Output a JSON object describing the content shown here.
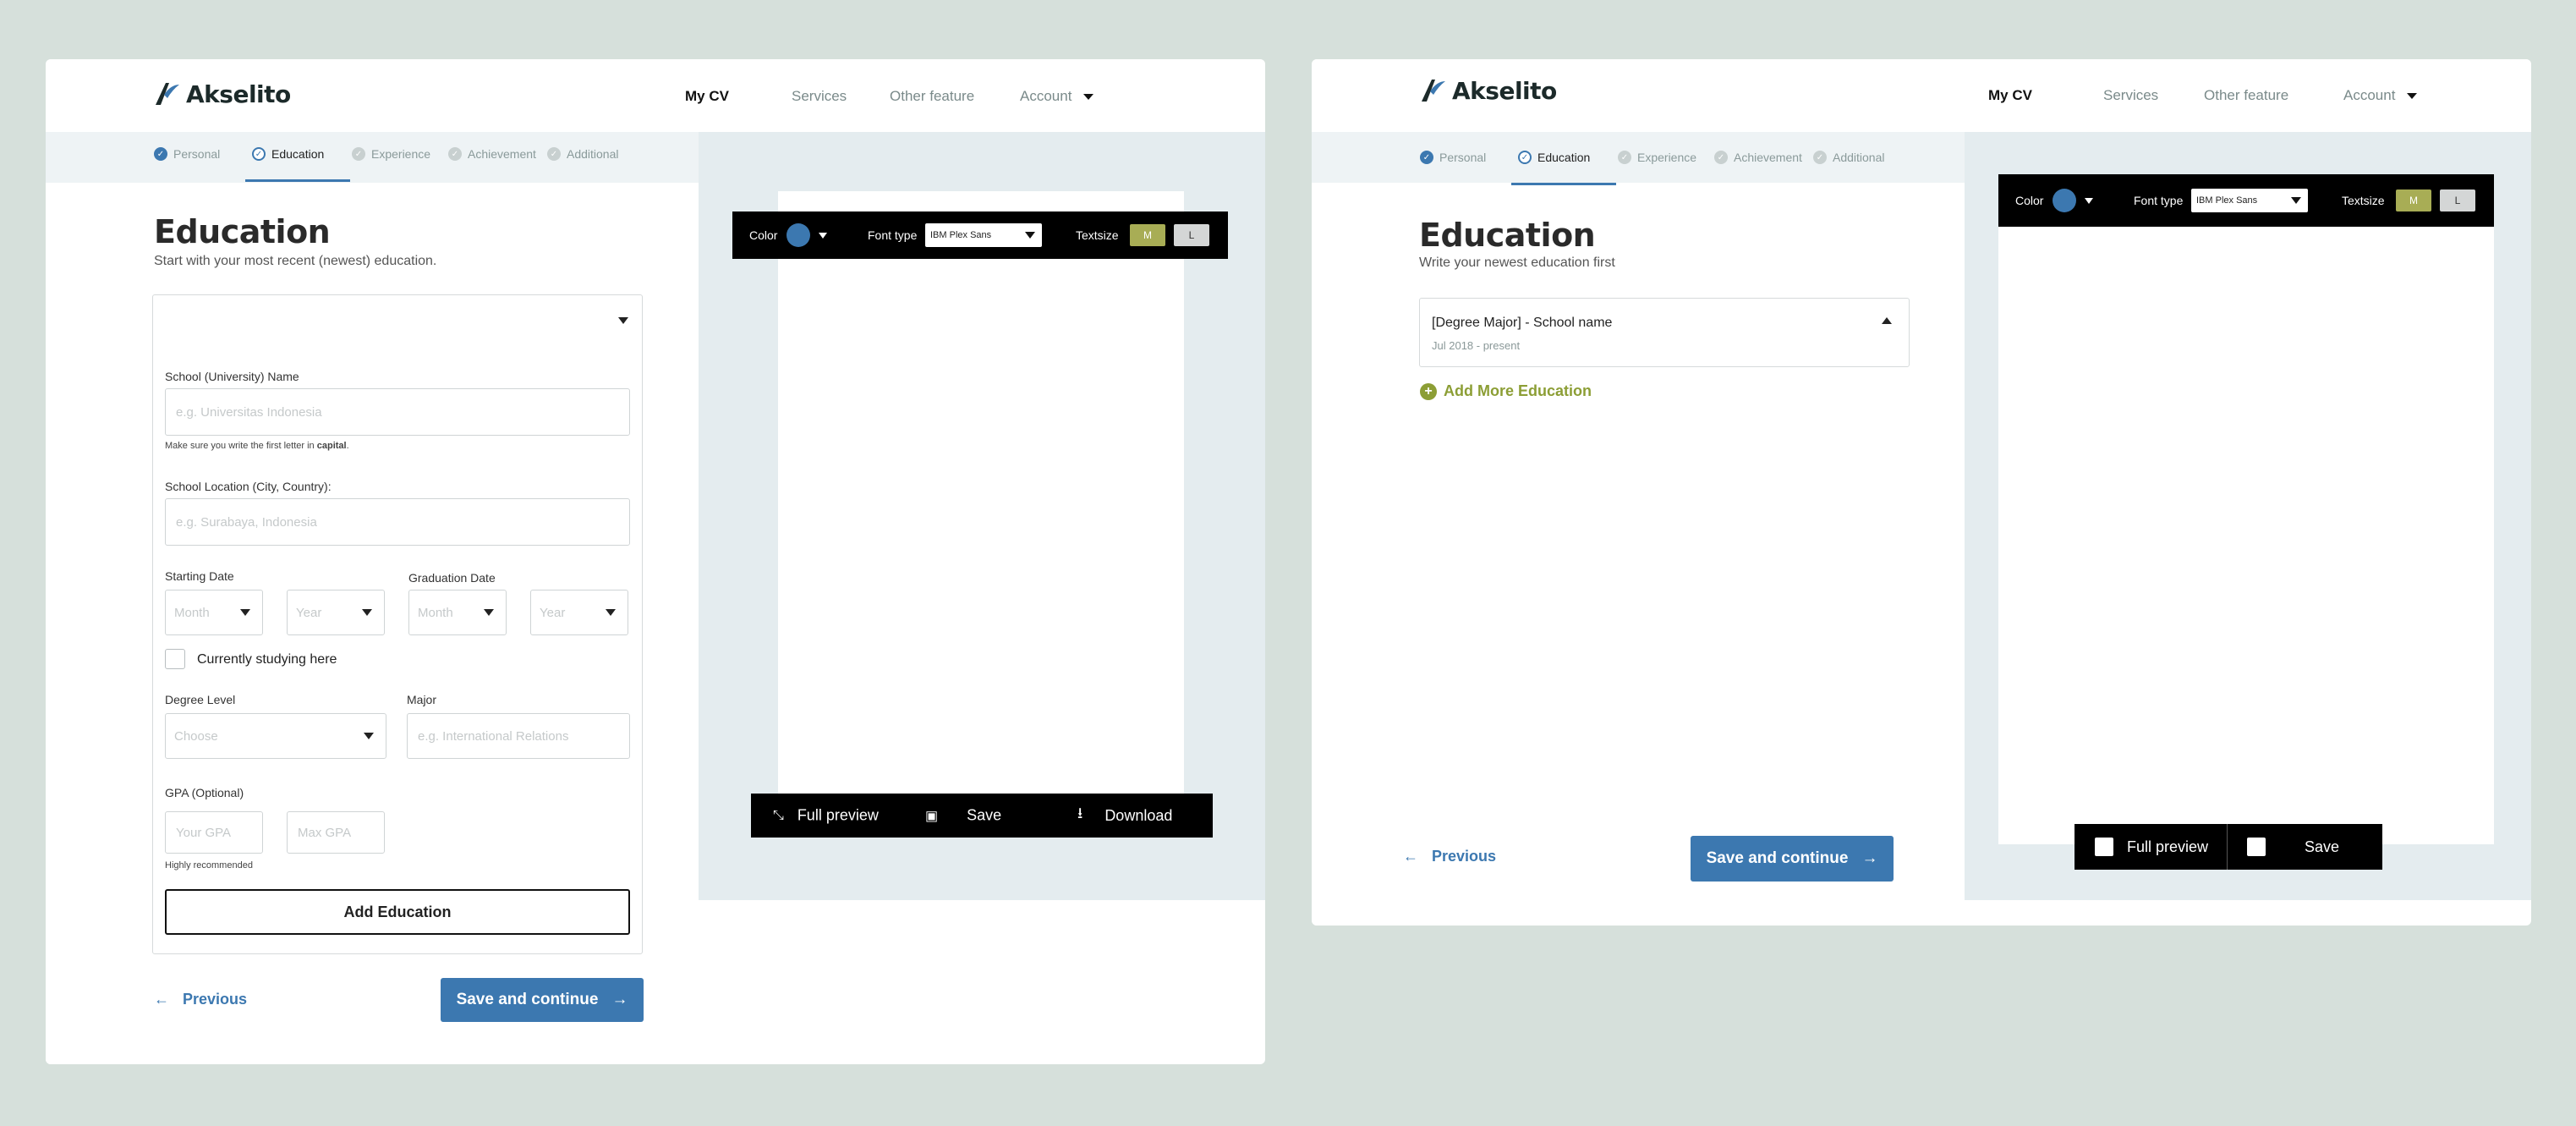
{
  "brand": {
    "name": "Akselito",
    "color": "#3c78b0",
    "accent": "#8c9e35"
  },
  "nav": {
    "my_cv": "My CV",
    "services": "Services",
    "other": "Other feature",
    "account": "Account"
  },
  "steps": [
    "Personal",
    "Education",
    "Experience",
    "Achievement",
    "Additional"
  ],
  "left_screen": {
    "title": "Education",
    "subtitle": "Start with your most recent (newest) education.",
    "form": {
      "school_label": "School (University) Name",
      "school_placeholder": "e.g. Universitas Indonesia",
      "hint_prefix": "Make sure you write the first letter in ",
      "hint_bold": "capital",
      "hint_suffix": ".",
      "location_label": "School Location (City, Country):",
      "location_placeholder": "e.g. Surabaya, Indonesia",
      "start_label": "Starting Date",
      "grad_label": "Graduation Date",
      "month": "Month",
      "year": "Year",
      "currently": "Currently studying here",
      "degree_label": "Degree Level",
      "degree_placeholder": "Choose",
      "major_label": "Major",
      "major_placeholder": "e.g. International Relations",
      "gpa_label": "GPA (Optional)",
      "gpa_placeholder": "Your GPA",
      "max_gpa_placeholder": "Max GPA",
      "gpa_hint": "Highly recommended",
      "add_button": "Add Education"
    },
    "previous": "Previous",
    "save_continue": "Save and continue"
  },
  "toolbar": {
    "color": "Color",
    "font_type": "Font type",
    "font_value": "IBM Plex Sans",
    "textsize": "Textsize",
    "size_m": "M",
    "size_l": "L"
  },
  "preview_actions": {
    "full_preview": "Full preview",
    "save": "Save",
    "download": "Download"
  },
  "right_screen": {
    "title": "Education",
    "subtitle": "Write your newest education first",
    "item_title": "[Degree Major] - School name",
    "item_dates": "Jul 2018 - present",
    "add_more": "Add More Education",
    "previous": "Previous",
    "save_continue": "Save and continue"
  }
}
